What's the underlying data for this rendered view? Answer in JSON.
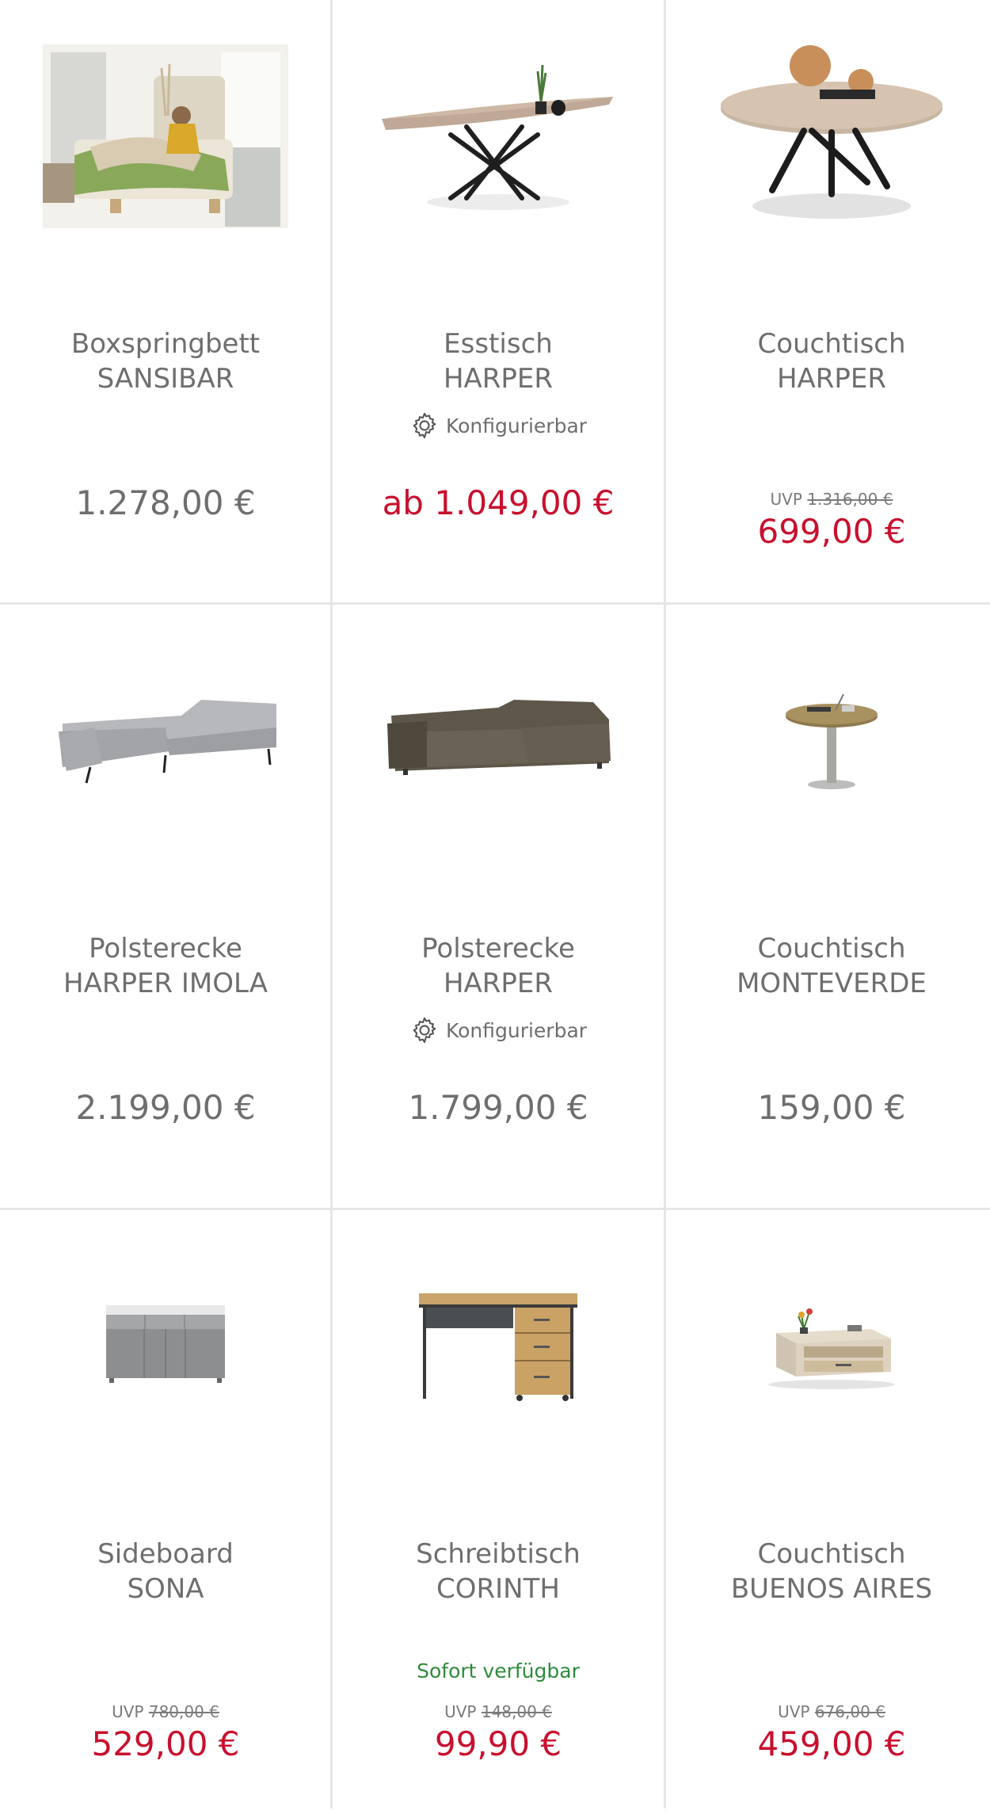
{
  "products": [
    {
      "name": "Boxspringbett",
      "model": "SANSIBAR",
      "price": "1.278,00 €",
      "image": "boxspring-bed-photo"
    },
    {
      "name": "Esstisch",
      "model": "HARPER",
      "badge": "Konfigurierbar",
      "price": "ab 1.049,00 €",
      "image": "dining-table"
    },
    {
      "name": "Couchtisch",
      "model": "HARPER",
      "uvp_label": "UVP",
      "uvp_price": "1.316,00 €",
      "price": "699,00 €",
      "image": "round-coffee-table"
    },
    {
      "name": "Polsterecke",
      "model": "HARPER IMOLA",
      "price": "2.199,00 €",
      "image": "grey-corner-sofa"
    },
    {
      "name": "Polsterecke",
      "model": "HARPER",
      "badge": "Konfigurierbar",
      "price": "1.799,00 €",
      "image": "brown-corner-sofa"
    },
    {
      "name": "Couchtisch",
      "model": "MONTEVERDE",
      "price": "159,00 €",
      "image": "small-round-table"
    },
    {
      "name": "Sideboard",
      "model": "SONA",
      "uvp_label": "UVP",
      "uvp_price": "780,00 €",
      "price": "529,00 €",
      "image": "grey-sideboard"
    },
    {
      "name": "Schreibtisch",
      "model": "CORINTH",
      "availability": "Sofort verfügbar",
      "uvp_label": "UVP",
      "uvp_price": "148,00 €",
      "price": "99,90 €",
      "image": "desk"
    },
    {
      "name": "Couchtisch",
      "model": "BUENOS AIRES",
      "uvp_label": "UVP",
      "uvp_price": "676,00 €",
      "price": "459,00 €",
      "image": "rect-coffee-table"
    }
  ],
  "colors": {
    "price_red": "#c8102e",
    "available_green": "#2e8b3a",
    "text_grey": "#6e6e6e",
    "divider": "#e6e6e6"
  }
}
